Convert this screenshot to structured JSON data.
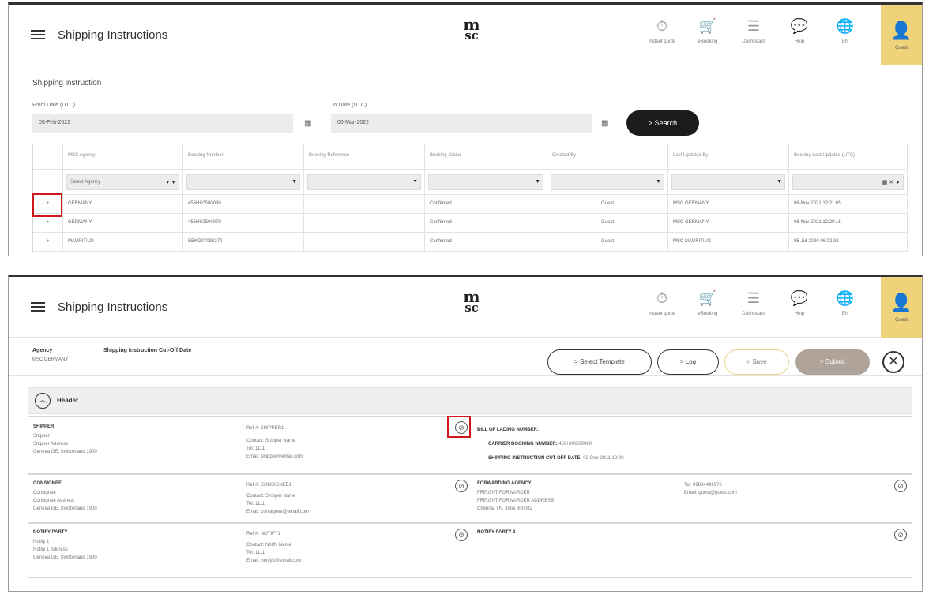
{
  "app": {
    "title": "Shipping Instructions",
    "logo_top": "m",
    "logo_bottom": "sc"
  },
  "nav": [
    {
      "icon": "stopwatch-icon",
      "glyph": "⏱",
      "label": "Instant quote"
    },
    {
      "icon": "cart-icon",
      "glyph": "🛒",
      "label": "eBooking"
    },
    {
      "icon": "dashboard-icon",
      "glyph": "☰",
      "label": "Dashboard"
    },
    {
      "icon": "help-icon",
      "glyph": "💬",
      "label": "Help"
    },
    {
      "icon": "globe-icon",
      "glyph": "🌐",
      "label": "EN"
    }
  ],
  "user": {
    "label": "Guest"
  },
  "panel1": {
    "section_title": "Shipping instruction",
    "from_label": "From Date (UTC)",
    "from_value": "05-Feb-2022",
    "to_label": "To Date (UTC)",
    "to_value": "06-Mar-2022",
    "search_label": "> Search",
    "columns": [
      "MSC Agency",
      "Booking Number",
      "Booking Reference",
      "Booking Status",
      "Created By",
      "Last Updated By",
      "Booking Last Updated (UTC)"
    ],
    "agency_filter": "Select Agency",
    "rows": [
      [
        "GERMANY",
        "456HK0500080",
        "",
        "Confirmed",
        "Guest",
        "MSC GERMANY",
        "06-Nov-2021 12:21:05"
      ],
      [
        "GERMANY",
        "456HK0500079",
        "",
        "Confirmed",
        "Guest",
        "MSC GERMANY",
        "06-Nov-2021 12:20:16"
      ],
      [
        "MAURITIUS",
        "EBKG07093270",
        "",
        "Confirmed",
        "Guest",
        "MSC MAURITIUS",
        "05-Jul-2020 06:02:38"
      ]
    ]
  },
  "panel2": {
    "agency_label": "Agency",
    "agency_value": "MSC GERMANY",
    "cutoff_label": "Shipping Instruction Cut-Off Date",
    "btn_template": "> Select Template",
    "btn_log": "> Log",
    "btn_save": "> Save",
    "btn_submit": "> Submit",
    "header_title": "Header",
    "shipper": {
      "title": "SHIPPER",
      "lines": [
        "Shipper",
        "Shipper Address",
        "Geneva GE, Switzerland 1900"
      ],
      "ref": "Ref #: SHIPPER1",
      "contact": "Contact: Shipper Name",
      "tel": "Tel: 1111",
      "email": "Email: shipper@email.com"
    },
    "bol": {
      "bol_label": "BILL OF LADING NUMBER:",
      "carrier_label": "CARRIER BOOKING NUMBER:",
      "carrier_value": "456HK0500080",
      "cutoff_label": "SHIPPING INSTRUCTION CUT OFF DATE:",
      "cutoff_value": "03-Dec-2021 12:00"
    },
    "consignee": {
      "title": "CONSIGNEE",
      "lines": [
        "Consignee",
        "Consignee Address",
        "Geneva GE, Switzerland 1900"
      ],
      "ref": "Ref #: CONSIGNEE1",
      "contact": "Contact: Shipper Name",
      "tel": "Tel: 1111",
      "email": "Email: consignee@email.com"
    },
    "forwarding": {
      "title": "FORWARDING AGENCY",
      "lines": [
        "FREIGHT FORWARDER",
        "FREIGHT FORWARDER ADDRESS",
        "Chennai TN, India 600082"
      ],
      "tel": "Tel: 09884499976",
      "email": "Email: guest@guest.com"
    },
    "notify": {
      "title": "NOTIFY PARTY",
      "lines": [
        "Notify 1",
        "Notify 1 Address",
        "Geneva GE, Switzerland 1900"
      ],
      "ref": "Ref #: NOTIFY1",
      "contact": "Contact: Notify Name",
      "tel": "Tel: 1111",
      "email": "Email: notify1@email.com"
    },
    "notify2": {
      "title": "NOTIFY PARTY 2"
    }
  }
}
